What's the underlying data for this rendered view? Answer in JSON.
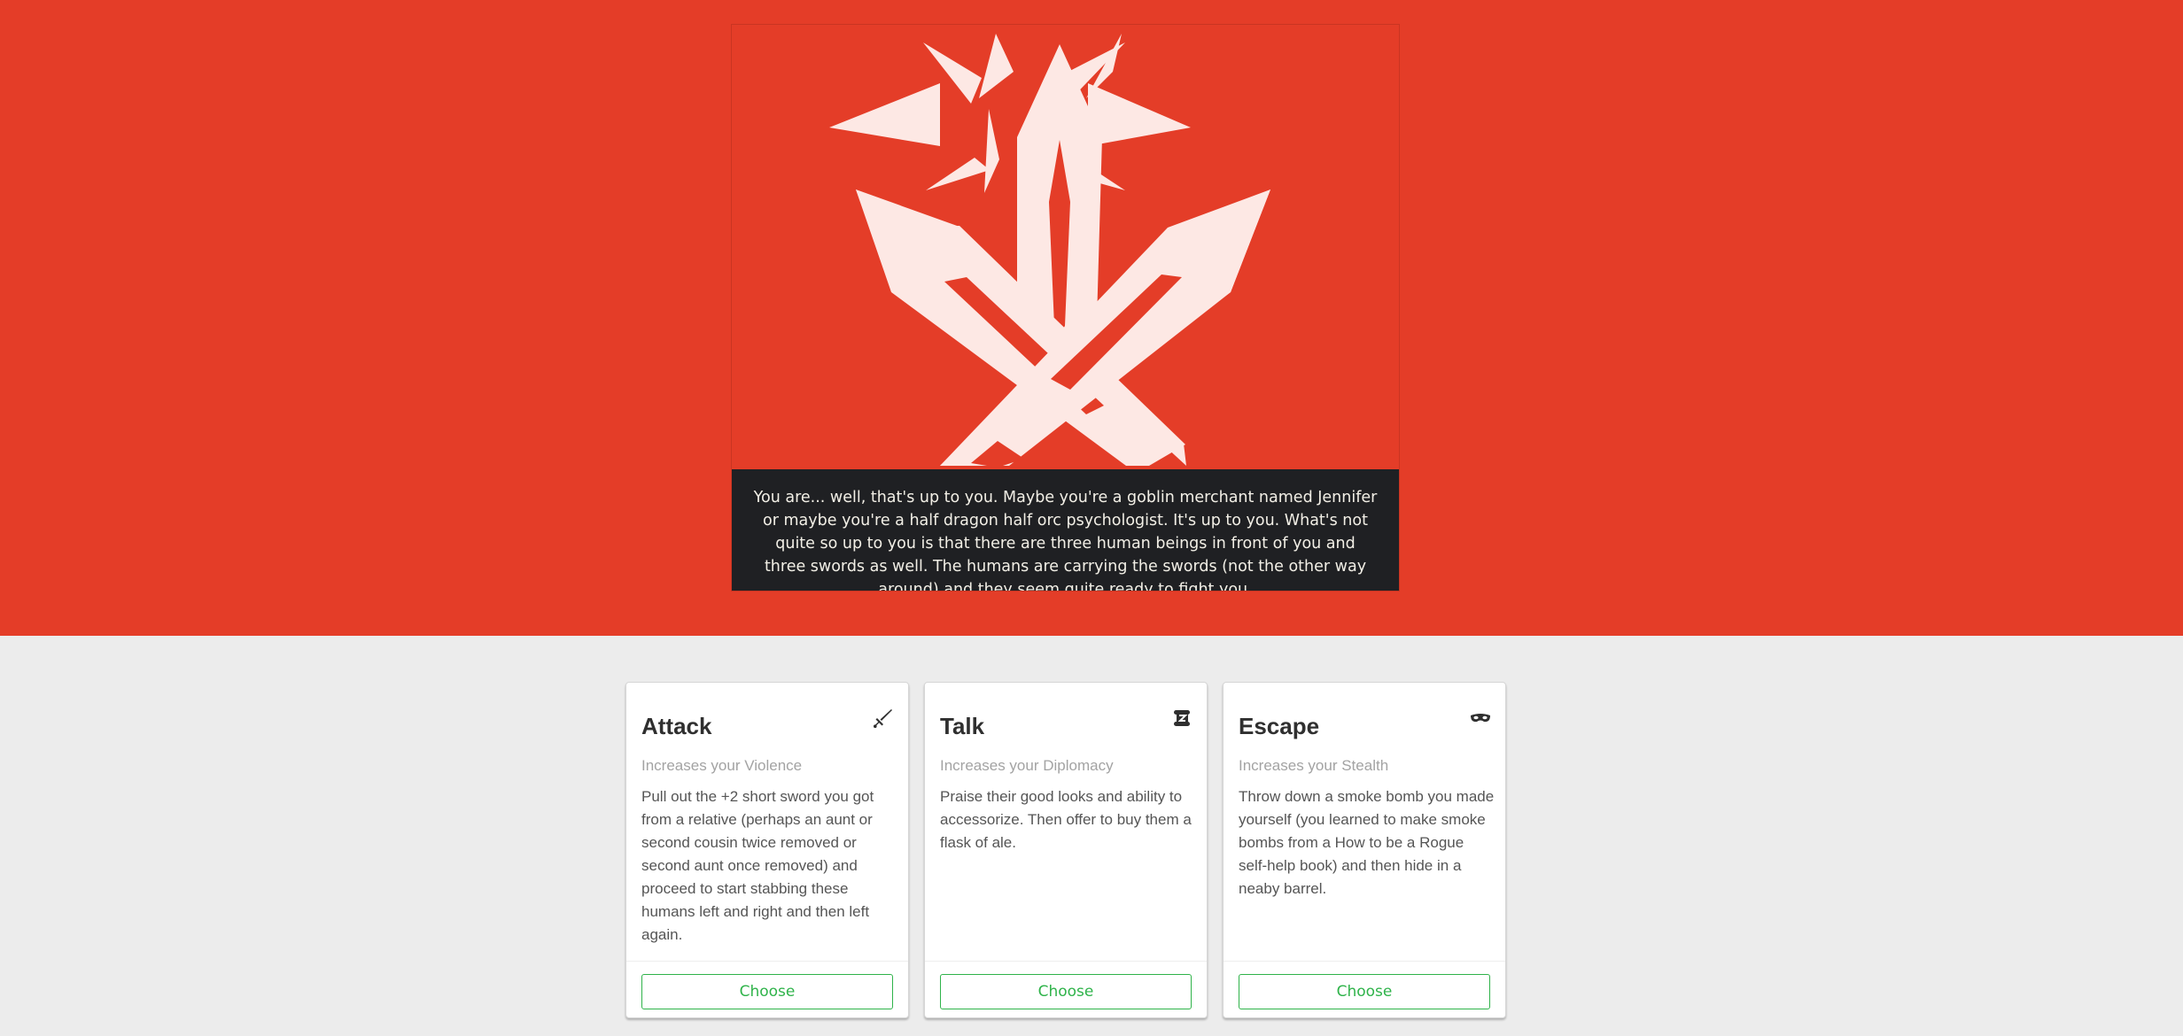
{
  "hero": {
    "emblem_icon": "crossed-swords-burst-icon",
    "caption": "You are... well, that's up to you. Maybe you're a goblin merchant named Jennifer or maybe you're a half dragon half orc psychologist. It's up to you. What's not quite so up to you is that there are three human beings in front of you and three swords as well. The humans are carrying the swords (not the other way around) and they seem quite ready to fight you."
  },
  "colors": {
    "hero_bg": "#e43d28",
    "emblem": "#fde8e4",
    "caption_bg": "#1f2023",
    "page_bg": "#ececec",
    "accent_green": "#2fb34a"
  },
  "choices": [
    {
      "title": "Attack",
      "icon": "sword-icon",
      "subtitle": "Increases your Violence",
      "text": "Pull out the +2 short sword you got from a relative (perhaps an aunt or second cousin twice removed or second aunt once removed) and proceed to start stabbing these humans left and right and then left again.",
      "button": "Choose"
    },
    {
      "title": "Talk",
      "icon": "scroll-icon",
      "subtitle": "Increases your Diplomacy",
      "text": "Praise their good looks and ability to accessorize. Then offer to buy them a flask of ale.",
      "button": "Choose"
    },
    {
      "title": "Escape",
      "icon": "mask-icon",
      "subtitle": "Increases your Stealth",
      "text": "Throw down a smoke bomb you made yourself (you learned to make smoke bombs from a How to be a Rogue self-help book) and then hide in a neaby barrel.",
      "button": "Choose"
    }
  ]
}
